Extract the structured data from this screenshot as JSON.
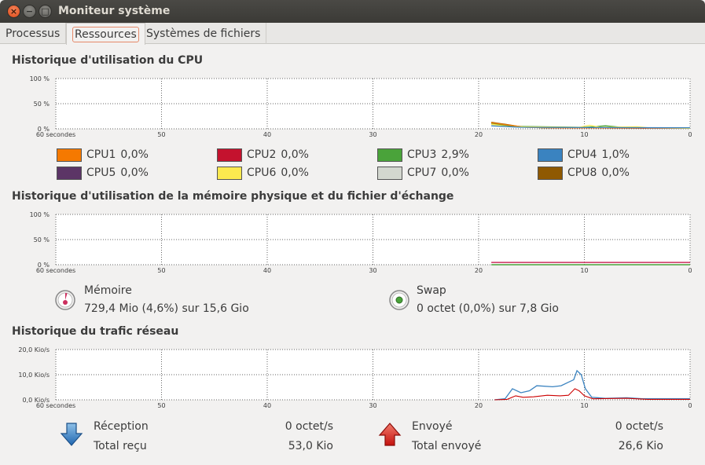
{
  "window": {
    "title": "Moniteur système",
    "close_glyph": "×",
    "min_glyph": "−",
    "max_glyph": "□"
  },
  "tabs": [
    {
      "label": "Processus"
    },
    {
      "label": "Ressources"
    },
    {
      "label": "Systèmes de fichiers"
    }
  ],
  "cpu": {
    "title": "Historique d'utilisation du CPU",
    "y_ticks": [
      "100 %",
      "50 %",
      "0 %"
    ],
    "x_ticks": [
      "60 secondes",
      "50",
      "40",
      "30",
      "20",
      "10",
      "0"
    ],
    "legend": [
      {
        "name": "CPU1",
        "value": "0,0%",
        "color": "#f57900"
      },
      {
        "name": "CPU2",
        "value": "0,0%",
        "color": "#c4122e"
      },
      {
        "name": "CPU3",
        "value": "2,9%",
        "color": "#4aa33a"
      },
      {
        "name": "CPU4",
        "value": "1,0%",
        "color": "#3a83c0"
      },
      {
        "name": "CPU5",
        "value": "0,0%",
        "color": "#5c3566"
      },
      {
        "name": "CPU6",
        "value": "0,0%",
        "color": "#fce94f"
      },
      {
        "name": "CPU7",
        "value": "0,0%",
        "color": "#d3d7cf"
      },
      {
        "name": "CPU8",
        "value": "0,0%",
        "color": "#8f5902"
      }
    ]
  },
  "memory": {
    "title": "Historique d'utilisation de la mémoire physique et du fichier d'échange",
    "y_ticks": [
      "100 %",
      "50 %",
      "0 %"
    ],
    "x_ticks": [
      "60 secondes",
      "50",
      "40",
      "30",
      "20",
      "10",
      "0"
    ],
    "mem_label": "Mémoire",
    "mem_value": "729,4 Mio (4,6%) sur 15,6 Gio",
    "mem_color": "#cc2e5e",
    "swap_label": "Swap",
    "swap_value": "0 octet (0,0%) sur 7,8 Gio",
    "swap_color": "#4aa33a"
  },
  "network": {
    "title": "Historique du trafic réseau",
    "y_ticks": [
      "20,0 Kio/s",
      "10,0 Kio/s",
      "0,0 Kio/s"
    ],
    "x_ticks": [
      "60 secondes",
      "50",
      "40",
      "30",
      "20",
      "10",
      "0"
    ],
    "recv_label": "Réception",
    "recv_rate": "0 octet/s",
    "recv_total_label": "Total reçu",
    "recv_total": "53,0 Kio",
    "sent_label": "Envoyé",
    "sent_rate": "0 octet/s",
    "sent_total_label": "Total envoyé",
    "sent_total": "26,6 Kio",
    "recv_color": "#3a83c0",
    "sent_color": "#cc0000"
  }
}
